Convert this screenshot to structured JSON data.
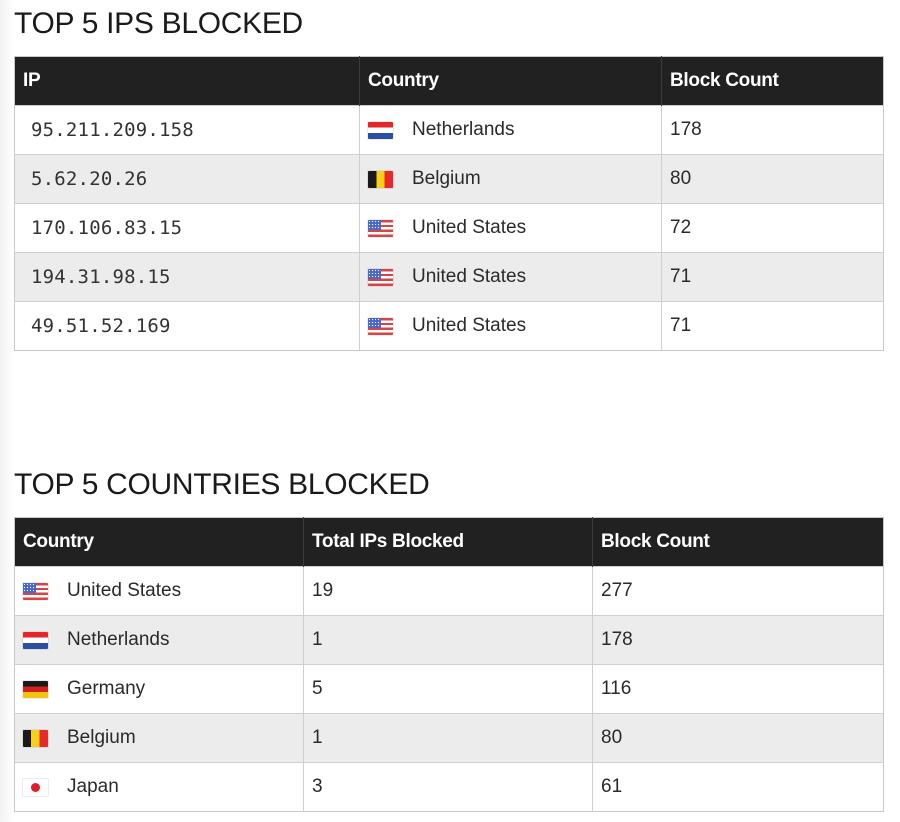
{
  "top_ips": {
    "title": "TOP 5 IPS BLOCKED",
    "columns": [
      "IP",
      "Country",
      "Block Count"
    ],
    "rows": [
      {
        "ip": "95.211.209.158",
        "country": "Netherlands",
        "flag": "flag-nl-icon",
        "block_count": "178"
      },
      {
        "ip": "5.62.20.26",
        "country": "Belgium",
        "flag": "flag-be-icon",
        "block_count": "80"
      },
      {
        "ip": "170.106.83.15",
        "country": "United States",
        "flag": "flag-us-icon",
        "block_count": "72"
      },
      {
        "ip": "194.31.98.15",
        "country": "United States",
        "flag": "flag-us-icon",
        "block_count": "71"
      },
      {
        "ip": "49.51.52.169",
        "country": "United States",
        "flag": "flag-us-icon",
        "block_count": "71"
      }
    ]
  },
  "top_countries": {
    "title": "TOP 5 COUNTRIES BLOCKED",
    "columns": [
      "Country",
      "Total IPs Blocked",
      "Block Count"
    ],
    "rows": [
      {
        "country": "United States",
        "flag": "flag-us-icon",
        "total_ips": "19",
        "block_count": "277"
      },
      {
        "country": "Netherlands",
        "flag": "flag-nl-icon",
        "total_ips": "1",
        "block_count": "178"
      },
      {
        "country": "Germany",
        "flag": "flag-de-icon",
        "total_ips": "5",
        "block_count": "116"
      },
      {
        "country": "Belgium",
        "flag": "flag-be-icon",
        "total_ips": "1",
        "block_count": "80"
      },
      {
        "country": "Japan",
        "flag": "flag-jp-icon",
        "total_ips": "3",
        "block_count": "61"
      }
    ]
  },
  "colors": {
    "header_bg": "#212121",
    "header_text": "#ffffff",
    "row_alt_bg": "#ececec",
    "border": "#cfcfcf"
  }
}
